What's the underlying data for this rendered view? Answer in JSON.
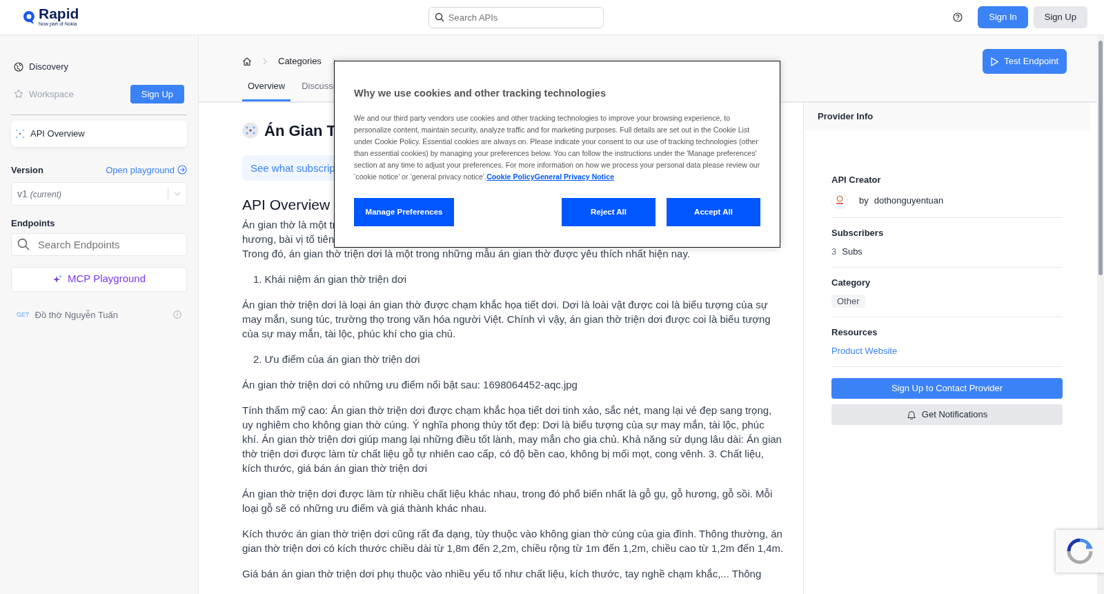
{
  "header": {
    "logo": {
      "name": "Rapid",
      "tagline": "Now part of Nokia"
    },
    "search": {
      "placeholder": "Search APIs"
    },
    "sign_in": "Sign In",
    "sign_up": "Sign Up"
  },
  "sidebar": {
    "nav": [
      {
        "label": "Discovery",
        "disabled": false
      },
      {
        "label": "Workspace",
        "disabled": true
      }
    ],
    "workspace_button": "Sign Up",
    "api_overview": {
      "label": "API Overview",
      "selected": true
    },
    "version": {
      "label": "Version",
      "link": "Open playground",
      "value": "v1",
      "note": "(current)"
    },
    "endpoints": {
      "label": "Endpoints",
      "placeholder": "Search Endpoints",
      "mcp_button": "MCP Playground",
      "items": [
        {
          "method": "GET",
          "name": "Đồ thờ Nguyễn Tuấn"
        }
      ]
    }
  },
  "main": {
    "breadcrumb": [
      "Categories"
    ],
    "tabs": [
      {
        "label": "Overview",
        "selected": true
      },
      {
        "label": "Discussi",
        "selected": false
      }
    ],
    "test_button": "Test Endpoint",
    "title": "Án Gian T",
    "subscription_link": "See what subscrip",
    "heading": "API Overview",
    "content": [
      {
        "kind": "lines",
        "lines": [
          "Án gian thờ là một tr",
          "hương, bài vị tổ tiên,",
          "Trong đó, án gian thờ triện dơi là một trong những mẫu án gian thờ được yêu thích nhất hiện nay."
        ]
      },
      {
        "kind": "item",
        "number": "1.",
        "text": "Khái niệm án gian thờ triện dơi"
      },
      {
        "kind": "paragraph",
        "text": "Án gian thờ triện dơi là loại án gian thờ được chạm khắc họa tiết dơi. Dơi là loài vật được coi là biểu tượng của sự may mắn, sung túc, trường thọ trong văn hóa người Việt. Chính vì vậy, án gian thờ triện dơi được coi là biểu tượng của sự may mắn, tài lộc, phúc khí cho gia chủ."
      },
      {
        "kind": "item",
        "number": "2.",
        "text": "Ưu điểm của án gian thờ triện dơi"
      },
      {
        "kind": "paragraph",
        "text": "Án gian thờ triện dơi có những ưu điểm nổi bật sau: 1698064452-aqc.jpg"
      },
      {
        "kind": "paragraph",
        "text": "Tính thẩm mỹ cao: Án gian thờ triện dơi được chạm khắc họa tiết dơi tinh xảo, sắc nét, mang lại vẻ đẹp sang trọng, uy nghiêm cho không gian thờ cúng. Ý nghĩa phong thủy tốt đẹp: Dơi là biểu tượng của sự may mắn, tài lộc, phúc khí. Án gian thờ triện dơi giúp mang lại những điều tốt lành, may mắn cho gia chủ. Khả năng sử dụng lâu dài: Án gian thờ triện dơi được làm từ chất liệu gỗ tự nhiên cao cấp, có độ bền cao, không bị mối mọt, cong vênh. 3. Chất liệu, kích thước, giá bán án gian thờ triện dơi"
      },
      {
        "kind": "paragraph",
        "text": "Án gian thờ triện dơi được làm từ nhiều chất liệu khác nhau, trong đó phổ biến nhất là gỗ gụ, gỗ hương, gỗ sồi. Mỗi loại gỗ sẽ có những ưu điểm và giá thành khác nhau."
      },
      {
        "kind": "paragraph",
        "text": "Kích thước án gian thờ triện dơi cũng rất đa dạng, tùy thuộc vào không gian thờ cúng của gia đình. Thông thường, án gian thờ triện dơi có kích thước chiều dài từ 1,8m đến 2,2m, chiều rộng từ 1m đến 1,2m, chiều cao từ 1,2m đến 1,4m."
      },
      {
        "kind": "lines",
        "lines": [
          "Giá bán án gian thờ triện dơi phụ thuộc vào nhiều yếu tố như chất liệu, kích thước, tay nghề chạm khắc,... Thông"
        ]
      }
    ]
  },
  "provider": {
    "title": "Provider Info",
    "creator_label": "API Creator",
    "by": "by",
    "creator": "dothonguyentuan",
    "subscribers_label": "Subscribers",
    "subscriber_count": "3",
    "subscriber_unit": "Subs",
    "category_label": "Category",
    "category": "Other",
    "resources_label": "Resources",
    "resource_link": "Product Website",
    "contact_button": "Sign Up to Contact Provider",
    "notify_button": "Get Notifications"
  },
  "cookie_dialog": {
    "title": "Why we use cookies and other tracking technologies",
    "body": "We and our third party vendors use cookies and other tracking technologies to improve your browsing experience, to personalize content, maintain security, analyze traffic and for marketing purposes. Full details are set out in the Cookie List under Cookie Policy. Essential cookies are always on. Please indicate your consent to our use of tracking technologies (other than essential cookies) by managing your preferences below. You can follow the instructions under the 'Manage preferences' section at any time to adjust your preferences. For more information on how we process your personal data please review our ‘cookie notice’ or ‘general privacy notice’.",
    "links": [
      "Cookie Policy",
      "General Privacy Notice"
    ],
    "buttons": [
      "Manage Preferences",
      "Reject All",
      "Accept All"
    ]
  }
}
